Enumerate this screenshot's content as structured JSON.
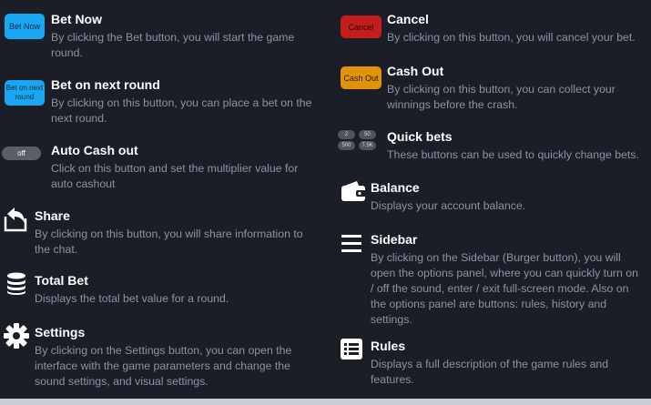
{
  "left": {
    "bet_now": {
      "button_label": "Bet Now",
      "title": "Bet Now",
      "desc": "By clicking the Bet button, you will start the game round."
    },
    "bet_next": {
      "button_label": "Bet on next round",
      "title": "Bet on next round",
      "desc": "By clicking on this button, you can place a bet on the next round."
    },
    "auto_cashout": {
      "toggle_label": "off",
      "title": "Auto Cash out",
      "desc": "Click on this button and set the multiplier value for auto cashout"
    },
    "share": {
      "icon": "share-icon",
      "title": "Share",
      "desc": "By clicking on this button, you will share information to the chat."
    },
    "total_bet": {
      "icon": "coins-stack-icon",
      "title": "Total Bet",
      "desc": "Displays the total bet value for a round."
    },
    "settings": {
      "icon": "gear-icon",
      "title": "Settings",
      "desc": "By clicking on the Settings button, you can open the interface with the game parameters and change the sound settings, and visual settings."
    }
  },
  "right": {
    "cancel": {
      "button_label": "Cancel",
      "title": "Cancel",
      "desc": "By clicking on this button, you will cancel your bet."
    },
    "cash_out": {
      "button_label": "Cash Out",
      "title": "Cash Out",
      "desc": "By clicking on this button, you can collect your winnings before the crash."
    },
    "quick_bets": {
      "chips": [
        "2",
        "50",
        "500",
        "7.5K"
      ],
      "title": "Quick bets",
      "desc": "These buttons can be used to quickly change bets."
    },
    "balance": {
      "icon": "wallet-icon",
      "title": "Balance",
      "desc": "Displays your account balance."
    },
    "sidebar": {
      "icon": "burger-menu-icon",
      "title": "Sidebar",
      "desc": "By clicking on the Sidebar (Burger button), you will open the options panel, where you can quickly turn on / off the sound, enter / exit full-screen mode. Also on the options panel are buttons: rules, history and settings."
    },
    "rules": {
      "icon": "rules-list-icon",
      "title": "Rules",
      "desc": "Displays a full description of the game rules and features."
    }
  },
  "colors": {
    "background": "#1b1e26",
    "bet_blue": "#19a7f3",
    "cancel_red": "#c31d1d",
    "cashout_orange": "#e19409",
    "desc_gray": "#8b93a6"
  }
}
